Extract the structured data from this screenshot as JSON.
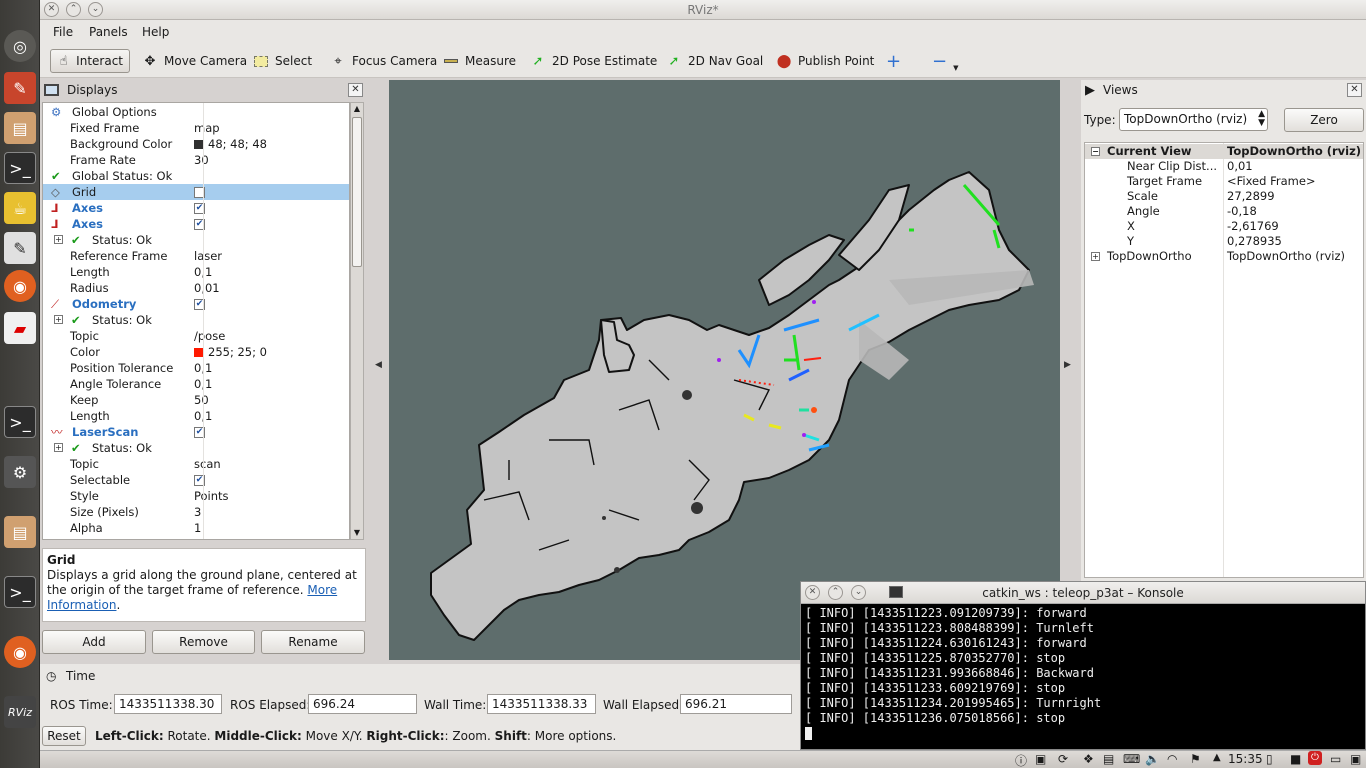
{
  "window": {
    "title": "RViz*"
  },
  "menu": [
    "File",
    "Panels",
    "Help"
  ],
  "toolbar": [
    {
      "label": "Interact",
      "icon": "cursor-icon"
    },
    {
      "label": "Move Camera",
      "icon": "move-camera-icon"
    },
    {
      "label": "Select",
      "icon": "select-icon"
    },
    {
      "label": "Focus Camera",
      "icon": "focus-camera-icon"
    },
    {
      "label": "Measure",
      "icon": "measure-icon"
    },
    {
      "label": "2D Pose Estimate",
      "icon": "pose-estimate-icon"
    },
    {
      "label": "2D Nav Goal",
      "icon": "nav-goal-icon"
    },
    {
      "label": "Publish Point",
      "icon": "publish-point-icon"
    }
  ],
  "displays": {
    "title": "Displays",
    "rows": [
      {
        "label": "Global Options",
        "value": ""
      },
      {
        "label": "Fixed Frame",
        "value": "map"
      },
      {
        "label": "Background Color",
        "value": "48; 48; 48"
      },
      {
        "label": "Frame Rate",
        "value": "30"
      },
      {
        "label": "Global Status: Ok",
        "value": ""
      },
      {
        "label": "Grid",
        "value": ""
      },
      {
        "label": "Axes",
        "value": ""
      },
      {
        "label": "Axes",
        "value": ""
      },
      {
        "label": "Status: Ok",
        "value": ""
      },
      {
        "label": "Reference Frame",
        "value": "laser"
      },
      {
        "label": "Length",
        "value": "0,1"
      },
      {
        "label": "Radius",
        "value": "0,01"
      },
      {
        "label": "Odometry",
        "value": ""
      },
      {
        "label": "Status: Ok",
        "value": ""
      },
      {
        "label": "Topic",
        "value": "/pose"
      },
      {
        "label": "Color",
        "value": "255; 25; 0"
      },
      {
        "label": "Position Tolerance",
        "value": "0,1"
      },
      {
        "label": "Angle Tolerance",
        "value": "0,1"
      },
      {
        "label": "Keep",
        "value": "50"
      },
      {
        "label": "Length",
        "value": "0,1"
      },
      {
        "label": "LaserScan",
        "value": ""
      },
      {
        "label": "Status: Ok",
        "value": ""
      },
      {
        "label": "Topic",
        "value": "scan"
      },
      {
        "label": "Selectable",
        "value": ""
      },
      {
        "label": "Style",
        "value": "Points"
      },
      {
        "label": "Size (Pixels)",
        "value": "3"
      },
      {
        "label": "Alpha",
        "value": "1"
      }
    ],
    "colors": {
      "background": "#303030",
      "odometry": "#ff1900"
    }
  },
  "description": {
    "title": "Grid",
    "text": "Displays a grid along the ground plane, centered at the origin of the target frame of reference.",
    "link": "More Information",
    "link_end": "."
  },
  "display_buttons": [
    "Add",
    "Remove",
    "Rename"
  ],
  "views": {
    "title": "Views",
    "type_label": "Type:",
    "type_value": "TopDownOrtho (rviz)",
    "zero_button": "Zero",
    "rows": [
      {
        "label": "Current View",
        "value": "TopDownOrtho (rviz)"
      },
      {
        "label": "Near Clip Dist...",
        "value": "0,01"
      },
      {
        "label": "Target Frame",
        "value": "<Fixed Frame>"
      },
      {
        "label": "Scale",
        "value": "27,2899"
      },
      {
        "label": "Angle",
        "value": "-0,18"
      },
      {
        "label": "X",
        "value": "-2,61769"
      },
      {
        "label": "Y",
        "value": "0,278935"
      },
      {
        "label": "TopDownOrtho",
        "value": "TopDownOrtho (rviz)"
      }
    ]
  },
  "time": {
    "title": "Time",
    "ros_time_label": "ROS Time:",
    "ros_time": "1433511338.30",
    "ros_elapsed_label": "ROS Elapsed:",
    "ros_elapsed": "696.24",
    "wall_time_label": "Wall Time:",
    "wall_time": "1433511338.33",
    "wall_elapsed_label": "Wall Elapsed:",
    "wall_elapsed": "696.21",
    "reset": "Reset",
    "hint_1b": "Left-Click:",
    "hint_1": " Rotate. ",
    "hint_2b": "Middle-Click:",
    "hint_2": " Move X/Y. ",
    "hint_3b": "Right-Click:",
    "hint_3": ": Zoom. ",
    "hint_4b": "Shift",
    "hint_4": ": More options."
  },
  "konsole": {
    "title": "catkin_ws : teleop_p3at – Konsole",
    "lines": [
      "[ INFO] [1433511223.091209739]: forward",
      "[ INFO] [1433511223.808488399]: Turnleft",
      "[ INFO] [1433511224.630161243]: forward",
      "[ INFO] [1433511225.870352770]: stop",
      "[ INFO] [1433511231.993668846]: Backward",
      "[ INFO] [1433511233.609219769]: stop",
      "[ INFO] [1433511234.201995465]: Turnright",
      "[ INFO] [1433511236.075018566]: stop"
    ]
  },
  "taskbar": {
    "clock": "15:35"
  }
}
